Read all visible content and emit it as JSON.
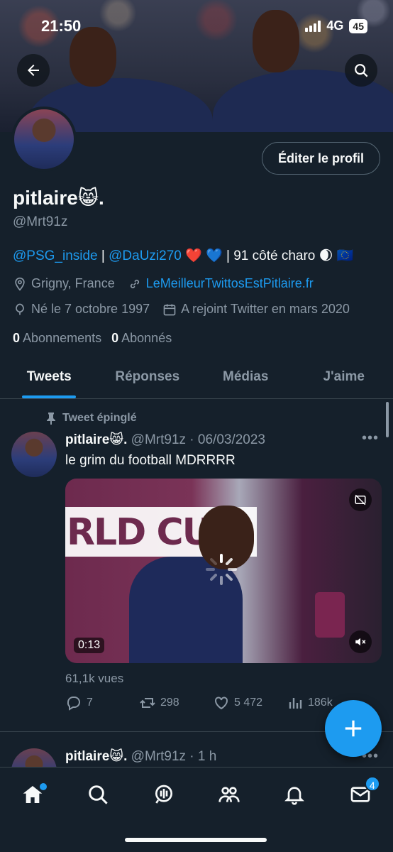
{
  "status": {
    "time": "21:50",
    "network": "4G",
    "battery": "45"
  },
  "profile": {
    "display_name": "pitlaire😸.",
    "handle": "@Mrt91z",
    "edit_label": "Éditer le profil",
    "bio_link1": "@PSG_inside",
    "bio_sep1": " | ",
    "bio_link2": "@DaUzi270",
    "bio_rest": " ❤️ 💙 | 91 côté charo 🌒 🇪🇺",
    "location": "Grigny, France",
    "website": "LeMeilleurTwittosEstPitlaire.fr",
    "born": "Né le 7 octobre 1997",
    "joined": "A rejoint Twitter en mars 2020",
    "following_count": "0",
    "following_label": "Abonnements",
    "followers_count": "0",
    "followers_label": "Abonnés"
  },
  "tabs": [
    "Tweets",
    "Réponses",
    "Médias",
    "J'aime"
  ],
  "pinned_tweet": {
    "pinned_label": "Tweet épinglé",
    "name": "pitlaire😸.",
    "meta": " @Mrt91z · 06/03/2023",
    "text": "le grim du football MDRRRR",
    "media_banner": "RLD CUP",
    "duration": "0:13",
    "views": "61,1k vues",
    "replies": "7",
    "retweets": "298",
    "likes": "5 472",
    "views_count": "186k"
  },
  "second_tweet": {
    "name": "pitlaire😸.",
    "meta": " @Mrt91z · 1 h"
  },
  "nav": {
    "messages_badge": "4"
  },
  "colors": {
    "background": "#15202b",
    "accent": "#1d9bf0",
    "muted": "#8b98a5"
  }
}
